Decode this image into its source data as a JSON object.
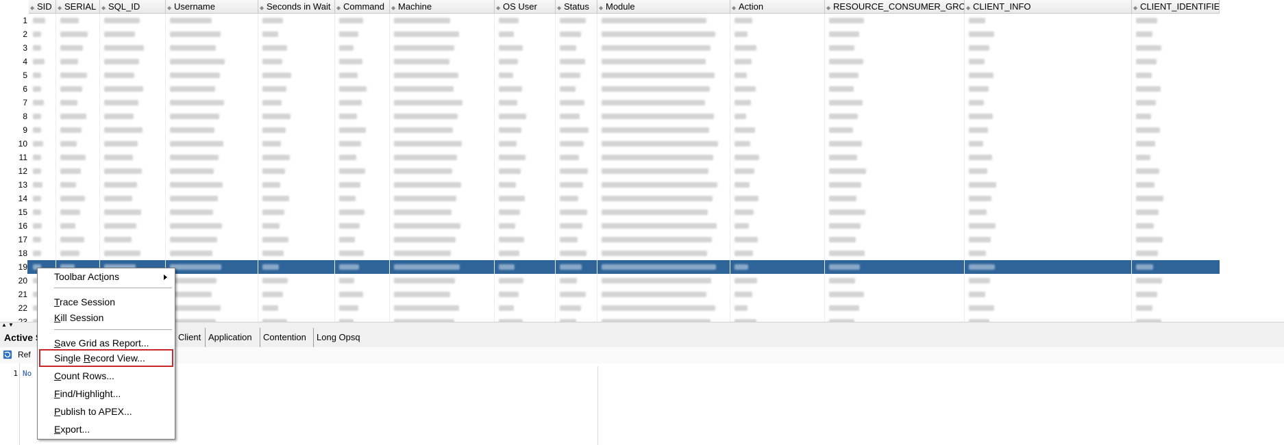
{
  "grid": {
    "columns": [
      "SID",
      "SERIAL",
      "SQL_ID",
      "Username",
      "Seconds in Wait",
      "Command",
      "Machine",
      "OS User",
      "Status",
      "Module",
      "Action",
      "RESOURCE_CONSUMER_GROUP",
      "CLIENT_INFO",
      "CLIENT_IDENTIFIER"
    ],
    "row_numbers": [
      "1",
      "2",
      "3",
      "4",
      "5",
      "6",
      "7",
      "8",
      "9",
      "10",
      "11",
      "12",
      "13",
      "14",
      "15",
      "16",
      "17",
      "18",
      "19",
      "20",
      "21",
      "22",
      "23"
    ],
    "selected_row": "19"
  },
  "tabs": [
    "Active S",
    "Client",
    "Application",
    "Contention",
    "Long Opsq"
  ],
  "toolbar": {
    "refresh_label": "Ref"
  },
  "editor": {
    "line_number": "1",
    "line_text": "No"
  },
  "context_menu": {
    "items": [
      {
        "before": "Toolbar Act",
        "u": "i",
        "after": "ons"
      },
      {
        "before": "",
        "u": "T",
        "after": "race Session"
      },
      {
        "before": "",
        "u": "K",
        "after": "ill Session"
      },
      {
        "before": "",
        "u": "S",
        "after": "ave Grid as Report..."
      },
      {
        "before": "Single ",
        "u": "R",
        "after": "ecord View..."
      },
      {
        "before": "",
        "u": "C",
        "after": "ount Rows..."
      },
      {
        "before": "",
        "u": "F",
        "after": "ind/Highlight..."
      },
      {
        "before": "",
        "u": "P",
        "after": "ublish to APEX..."
      },
      {
        "before": "",
        "u": "E",
        "after": "xport..."
      }
    ]
  },
  "colors": {
    "selection": "#2f6499",
    "highlight_border": "#c8282a"
  },
  "icons": {
    "submenu": "chevron-right-icon",
    "refresh": "refresh-icon",
    "sort": "sort-arrows-icon"
  }
}
